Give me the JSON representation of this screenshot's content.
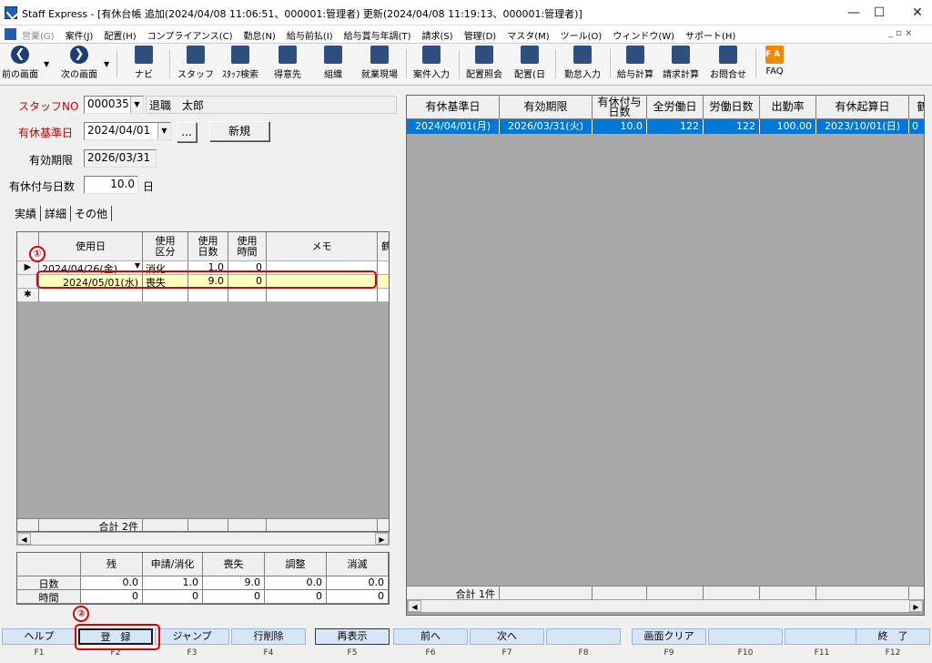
{
  "window": {
    "title": "Staff Express - [有休台帳 追加(2024/04/08 11:06:51、000001:管理者) 更新(2024/04/08 11:19:13、000001:管理者)]",
    "minimize": "—",
    "maximize": "☐",
    "close": "✕",
    "mdi_controls": "_ ▫ ×"
  },
  "menu": {
    "items": [
      "営業(G)",
      "案件(J)",
      "配置(H)",
      "コンプライアンス(C)",
      "勤怠(N)",
      "給与前払(I)",
      "給与賞与年調(T)",
      "請求(S)",
      "管理(D)",
      "マスタ(M)",
      "ツール(O)",
      "ウィンドウ(W)",
      "サポート(H)"
    ]
  },
  "toolbar": {
    "prev": "前の画面",
    "next": "次の画面",
    "navi": "ナビ",
    "staff": "スタッフ",
    "staff_search": "ｽﾀｯﾌ検索",
    "client": "得意先",
    "org": "組織",
    "site": "就業現場",
    "case_input": "案件入力",
    "assign_inquiry": "配置照会",
    "assign_day": "配置(日",
    "attendance_input": "勤怠入力",
    "payroll_calc": "給与計算",
    "billing_calc": "請求計算",
    "inquiry": "お問合せ",
    "faq": "FAQ",
    "faq_icon": "F A Q"
  },
  "form": {
    "staff_no_label": "スタッフNO",
    "staff_no": "000035",
    "staff_name": "退職　太郎",
    "base_date_label": "有休基準日",
    "base_date": "2024/04/01",
    "ellipsis_button": "...",
    "new_button": "新規",
    "valid_until_label": "有効期限",
    "valid_until": "2026/03/31",
    "grant_days_label": "有休付与日数",
    "grant_days": "10.0",
    "grant_days_unit": "日"
  },
  "tabs": [
    "実績",
    "詳細",
    "その他"
  ],
  "usage_grid": {
    "columns": [
      "使用日",
      "使用\n区分",
      "使用\n日数",
      "使用\n時間",
      "メモ",
      "鶴"
    ],
    "rows": [
      {
        "marker": "▶",
        "date": "2024/04/26(金)",
        "type": "消化",
        "days": "1.0",
        "hours": "0",
        "memo": ""
      },
      {
        "marker": "",
        "date": "2024/05/01(水)",
        "type": "喪失",
        "days": "9.0",
        "hours": "0",
        "memo": ""
      },
      {
        "marker": "✱",
        "date": "",
        "type": "",
        "days": "",
        "hours": "",
        "memo": ""
      }
    ],
    "total_label": "合計 2件"
  },
  "balance": {
    "columns": [
      "残",
      "申請/消化",
      "喪失",
      "調整",
      "消滅"
    ],
    "rows": [
      {
        "label": "日数",
        "values": [
          "0.0",
          "1.0",
          "9.0",
          "0.0",
          "0.0"
        ]
      },
      {
        "label": "時間",
        "values": [
          "0",
          "0",
          "0",
          "0",
          "0"
        ]
      }
    ]
  },
  "ledger_grid": {
    "columns": [
      "有休基準日",
      "有効期限",
      "有休付与\n日数",
      "全労働日",
      "労働日数",
      "出勤率",
      "有休起算日",
      "鶴"
    ],
    "rows": [
      {
        "base_date": "2024/04/01(月)",
        "valid_until": "2026/03/31(火)",
        "grant_days": "10.0",
        "total_work_days": "122",
        "work_days": "122",
        "attendance_rate": "100.00",
        "start_date": "2023/10/01(日)",
        "extra": "0"
      }
    ],
    "total_label": "合計 1件"
  },
  "fkeys": [
    {
      "label": "ヘルプ",
      "key": "F1"
    },
    {
      "label": "登　録",
      "key": "F2"
    },
    {
      "label": "ジャンプ",
      "key": "F3"
    },
    {
      "label": "行削除",
      "key": "F4"
    },
    {
      "label": "再表示",
      "key": "F5"
    },
    {
      "label": "前へ",
      "key": "F6"
    },
    {
      "label": "次へ",
      "key": "F7"
    },
    {
      "label": "",
      "key": "F8"
    },
    {
      "label": "画面クリア",
      "key": "F9"
    },
    {
      "label": "",
      "key": "F10"
    },
    {
      "label": "",
      "key": "F11"
    },
    {
      "label": "終　了",
      "key": "F12"
    }
  ],
  "annotations": {
    "callout_1": "①",
    "callout_2": "②"
  },
  "colors": {
    "selection": "#0078d7",
    "highlight_row": "#ffffc0",
    "callout": "#e00000",
    "label_red": "#d00000"
  }
}
